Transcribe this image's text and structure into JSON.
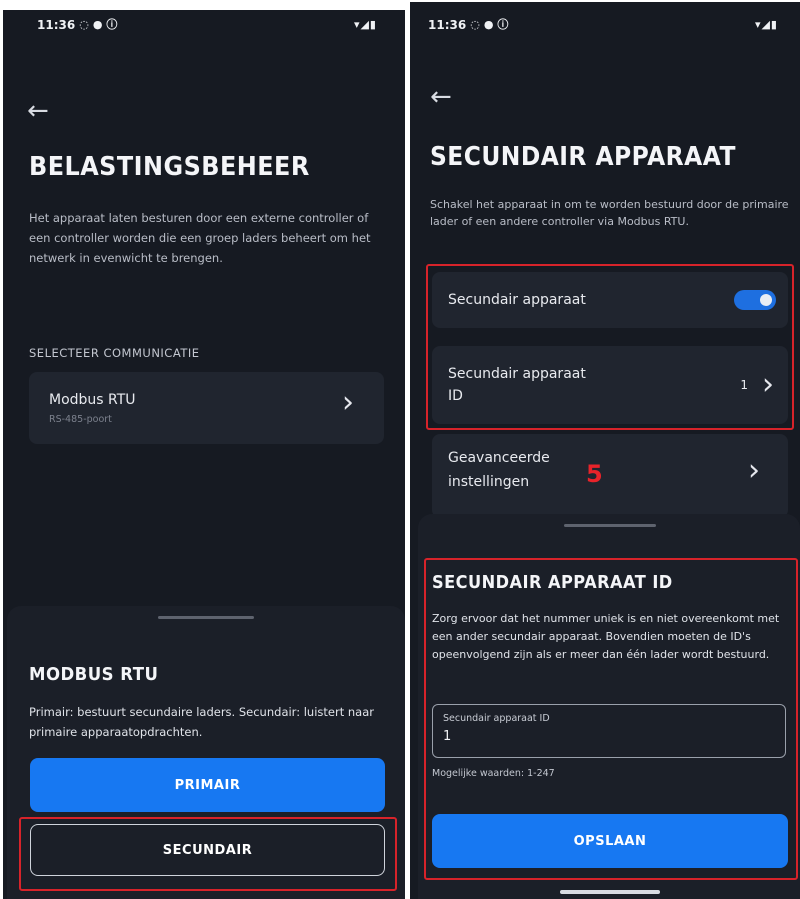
{
  "left": {
    "status": {
      "time": "11:36",
      "sys_icons": "▾◢▮"
    },
    "back_glyph": "←",
    "title": "BELASTINGSBEHEER",
    "description": "Het apparaat laten besturen door een externe controller of een controller worden die een groep laders beheert om het netwerk in evenwicht te brengen.",
    "section_label": "SELECTEER COMMUNICATIE",
    "comm_item": {
      "title": "Modbus RTU",
      "subtitle": "RS-485-poort",
      "chevron": "›"
    },
    "sheet": {
      "title": "MODBUS RTU",
      "description": "Primair: bestuurt secundaire laders. Secundair: luistert naar primaire apparaatopdrachten.",
      "primary_label": "PRIMAIR",
      "secondary_label": "SECUNDAIR"
    }
  },
  "right": {
    "status": {
      "time": "11:36",
      "sys_icons": "▾◢▮"
    },
    "back_glyph": "←",
    "title": "SECUNDAIR APPARAAT",
    "description": "Schakel het apparaat in om te worden bestuurd door de primaire lader of een andere controller via Modbus RTU.",
    "secondary_toggle": {
      "label": "Secundair apparaat",
      "state": "on"
    },
    "secondary_id_row": {
      "label_line1": "Secundair apparaat",
      "label_line2": "ID",
      "value": "1",
      "chevron": "›"
    },
    "advanced_row": {
      "label_line1": "Geavanceerde",
      "label_line2": "instellingen",
      "chevron": "›"
    },
    "annotation": "5",
    "sheet": {
      "title": "SECUNDAIR APPARAAT ID",
      "description": "Zorg ervoor dat het nummer uniek is en niet overeenkomt met een ander secundair apparaat. Bovendien moeten de ID's opeenvolgend zijn als er meer dan één lader wordt bestuurd.",
      "field_label": "Secundair apparaat ID",
      "field_value": "1",
      "hint": "Mogelijke waarden: 1-247",
      "save_label": "OPSLAAN"
    }
  },
  "colors": {
    "background": "#161a22",
    "card": "#20252f",
    "accent": "#1778f2",
    "highlight": "#d7232a"
  }
}
